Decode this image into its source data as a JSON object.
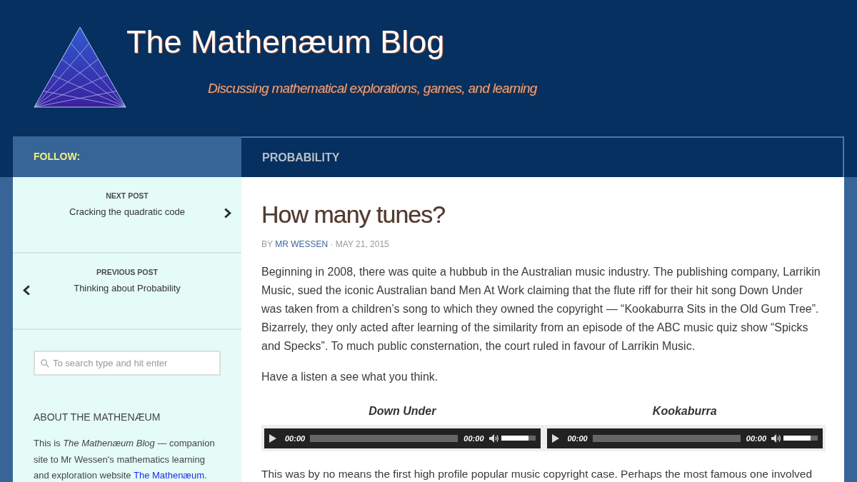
{
  "header": {
    "title": "The Mathenæum Blog",
    "tagline": "Discussing mathematical explorations, games, and learning"
  },
  "nav": {
    "follow_label": "FOLLOW:",
    "category": "PROBABILITY"
  },
  "sidebar": {
    "post_nav": [
      {
        "kind": "next",
        "label": "NEXT POST",
        "title": "Cracking the quadratic code"
      },
      {
        "kind": "previous",
        "label": "PREVIOUS POST",
        "title": "Thinking about Probability"
      }
    ],
    "search": {
      "placeholder": "To search type and hit enter"
    },
    "about": {
      "heading": "ABOUT THE MATHENÆUM",
      "text": "This is *The Mathenæum Blog* — companion site to Mr Wessen's mathematics learning and exploration website",
      "link": "The Mathenæum",
      "after": "."
    }
  },
  "post": {
    "title": "How many tunes?",
    "meta": {
      "by": "BY",
      "author": "MR WESSEN",
      "rest": "· MAY 21, 2015"
    },
    "paragraphs_before": [
      "Beginning in 2008, there was quite a hubbub in the Australian music industry. The publishing company, Larrikin Music, sued the iconic Australian band Men At Work claiming that the flute riff for their hit song Down Under was taken from a children’s song to which they owned the copyright — “Kookaburra Sits in the Old Gum Tree”. Bizarrely, they only acted after learning of the similarity from an episode of the ABC music quiz show “Spicks and Specks”. To much public consternation, the court ruled in favour of Larrikin Music.",
      "Have a listen a see what you think."
    ],
    "players": [
      {
        "title": "Down Under",
        "current": "00:00",
        "duration": "00:00",
        "volume": {
          "level": 0.8
        }
      },
      {
        "title": "Kookaburra",
        "current": "00:00",
        "duration": "00:00",
        "volume": {
          "level": 0.8
        }
      }
    ],
    "paragraphs_after": [
      "This was by no means the first high profile popular music copyright case. Perhaps the most famous one involved"
    ]
  }
}
